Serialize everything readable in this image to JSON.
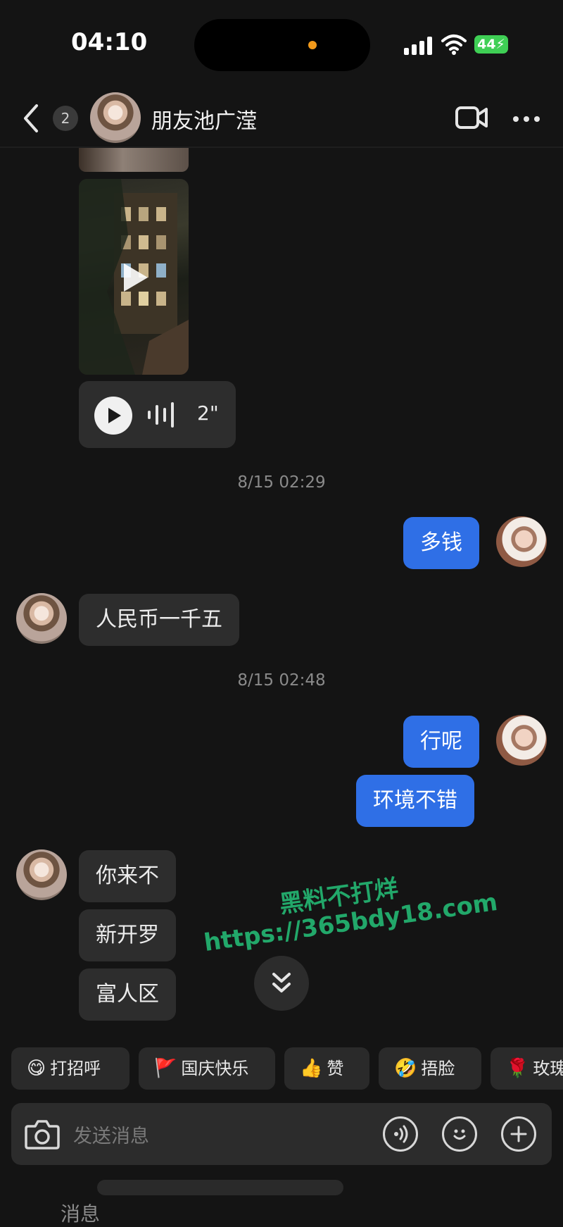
{
  "status_bar": {
    "time": "04:10",
    "battery": "44",
    "icons": [
      "signal-icon",
      "wifi-icon",
      "battery-charging-icon"
    ]
  },
  "header": {
    "unread_count": "2",
    "contact_name": "朋友池广滢",
    "icons": [
      "back-icon",
      "video-call-icon",
      "more-icon"
    ]
  },
  "chat": {
    "voice_message": {
      "duration": "2\""
    },
    "timestamp_1": "8/15 02:29",
    "msg_out_1": "多钱",
    "msg_in_1": "人民币一千五",
    "timestamp_2": "8/15 02:48",
    "msg_out_2": "行呢",
    "msg_out_3": "环境不错",
    "msg_in_2": "你来不",
    "msg_in_3": "新开罗",
    "msg_in_4": "富人区"
  },
  "watermark": {
    "line1": "黑料不打烊",
    "line2": "https://365bdy18.com"
  },
  "quick_replies": [
    {
      "emoji": "😋",
      "label": "打招呼"
    },
    {
      "emoji": "🚩",
      "label": "国庆快乐"
    },
    {
      "emoji": "👍",
      "label": "赞"
    },
    {
      "emoji": "🤣",
      "label": "捂脸"
    },
    {
      "emoji": "🌹",
      "label": "玫瑰"
    }
  ],
  "composer": {
    "placeholder": "发送消息",
    "icons": [
      "camera-icon",
      "voice-input-icon",
      "emoji-icon",
      "add-icon"
    ]
  },
  "bottom_tab": {
    "label": "消息"
  },
  "colors": {
    "background": "#141414",
    "outgoing_bubble": "#2f6fe6",
    "incoming_bubble": "#2d2d2d",
    "watermark": "#22a86a"
  }
}
